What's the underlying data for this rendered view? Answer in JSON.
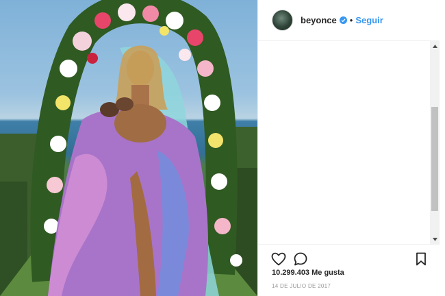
{
  "post": {
    "username": "beyonce",
    "follow_label": "Seguir",
    "separator": "•",
    "likes_text": "10.299.403 Me gusta",
    "date_text": "14 DE JULIO DE 2017"
  },
  "icons": {
    "like": "heart-icon",
    "comment": "comment-icon",
    "save": "bookmark-icon",
    "verified": "verified-badge-icon"
  },
  "colors": {
    "accent": "#3897f0",
    "text": "#262626",
    "muted": "#999999",
    "border": "#efefef"
  }
}
